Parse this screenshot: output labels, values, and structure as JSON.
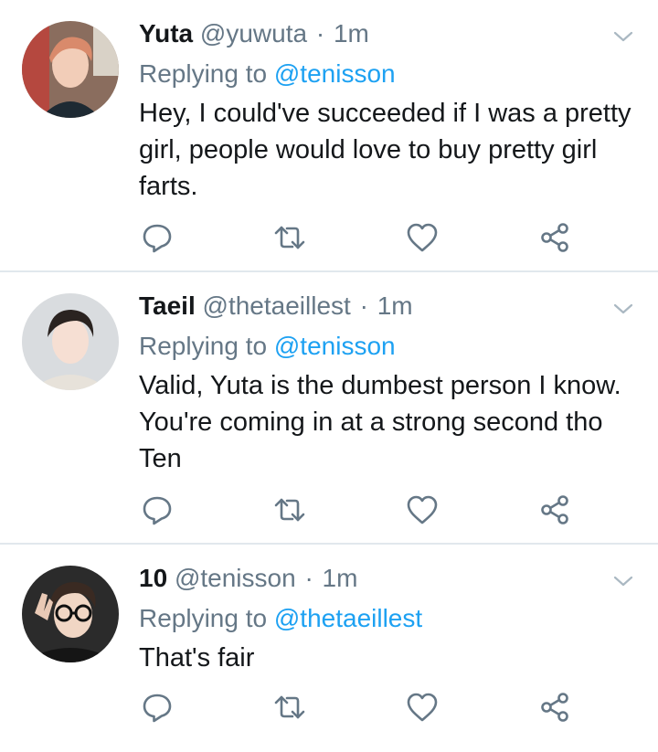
{
  "colors": {
    "text": "#14171a",
    "muted": "#657786",
    "link": "#1da1f2",
    "divider": "#e1e8ed",
    "icon": "#657786"
  },
  "icons": {
    "reply": "reply-icon",
    "retweet": "retweet-icon",
    "like": "heart-icon",
    "share": "share-icon",
    "menu": "chevron-down-icon"
  },
  "tweets": [
    {
      "name": "Yuta",
      "handle": "@yuwuta",
      "separator": "·",
      "time": "1m",
      "replying_prefix": "Replying to",
      "replying_to": "@tenisson",
      "text": "Hey, I could've succeeded if I was a pretty girl, people would love to buy pretty girl farts."
    },
    {
      "name": "Taeil",
      "handle": "@thetaeillest",
      "separator": "·",
      "time": "1m",
      "replying_prefix": "Replying to",
      "replying_to": "@tenisson",
      "text": "Valid, Yuta is the dumbest person I know. You're coming in at a strong second tho Ten"
    },
    {
      "name": "10",
      "handle": "@tenisson",
      "separator": "·",
      "time": "1m",
      "replying_prefix": "Replying to",
      "replying_to": "@thetaeillest",
      "text": "That's fair"
    }
  ]
}
